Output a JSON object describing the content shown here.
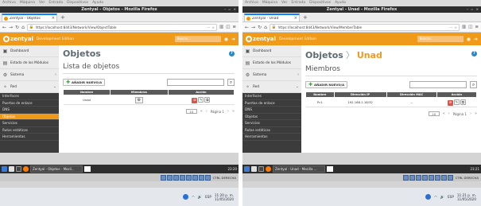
{
  "vm_menu": [
    "Archivo",
    "Máquina",
    "Ver",
    "Entrada",
    "Dispositivos",
    "Ayuda"
  ],
  "panes": [
    {
      "window_title": "Zentyal - Objetos - Mozilla Firefox",
      "tab_title": "Zentyal - Objetos",
      "url": "https://localhost:8443/Network/View/ObjectTable",
      "brand": "zentyal",
      "edition": "Development Edition",
      "search_placeholder": "Buscar...",
      "sidebar": {
        "items": [
          {
            "label": "Dashboard",
            "chevron": ""
          },
          {
            "label": "Estado de los Módulos",
            "chevron": ""
          },
          {
            "label": "Sistema",
            "chevron": "‹"
          },
          {
            "label": "Red",
            "chevron": "⌄"
          }
        ],
        "subitems": [
          "Interfaces",
          "Puertas de enlace",
          "DNS",
          "Objetos",
          "Servicios",
          "Rutas estáticas",
          "Herramientas"
        ],
        "active": "Objetos"
      },
      "page_title": "Objetos",
      "page_title_sub": "",
      "content_title": "Lista de objetos",
      "add_button": "AÑADIR NUEVO/A",
      "columns": [
        "Nombre",
        "Miembros",
        "Acción"
      ],
      "rows": [
        [
          "Unad",
          "⚙",
          ""
        ]
      ],
      "page_size": "10",
      "page_label": "Página 1",
      "taskbar_task": "Zentyal - Objetos - Mozil...",
      "taskbar_clock": "23:20",
      "vm_hostkey": "CTRL DERECHA",
      "tray_time": "11:20 p. m.",
      "tray_date": "11/05/2020",
      "tray_lang": "ESP"
    },
    {
      "window_title": "Zentyal - Unad - Mozilla Firefox",
      "tab_title": "Zentyal - Unad",
      "url": "https://localhost:8443/Network/View/MemberTable",
      "brand": "zentyal",
      "edition": "Development Edition",
      "search_placeholder": "Buscar...",
      "sidebar": {
        "items": [
          {
            "label": "Dashboard",
            "chevron": ""
          },
          {
            "label": "Estado de los Módulos",
            "chevron": ""
          },
          {
            "label": "Sistema",
            "chevron": "‹"
          },
          {
            "label": "Red",
            "chevron": "⌄"
          }
        ],
        "subitems": [
          "Interfaces",
          "Puertas de enlace",
          "DNS",
          "Objetos",
          "Servicios",
          "Rutas estáticas",
          "Herramientas"
        ],
        "active": ""
      },
      "page_title": "Objetos",
      "page_title_sub": "Unad",
      "content_title": "Miembros",
      "add_button": "AÑADIR NUEVO/A",
      "columns": [
        "Nombre",
        "Dirección IP",
        "Dirección MAC",
        "Acción"
      ],
      "rows": [
        [
          "Pc1",
          "192.168.1.18/32",
          "--",
          ""
        ]
      ],
      "page_size": "10",
      "page_label": "Página 1",
      "taskbar_task": "Zentyal - Unad - Mozilla ...",
      "taskbar_clock": "23:21",
      "vm_hostkey": "CTRL DERECHA",
      "tray_time": "11:21 p. m.",
      "tray_date": "11/05/2020",
      "tray_lang": "ESP"
    }
  ],
  "colors": {
    "brand_orange": "#f09a1a",
    "sidebar_dark": "#3c3c3c",
    "table_header": "#5a5a5a",
    "delete_red": "#d9534f"
  }
}
